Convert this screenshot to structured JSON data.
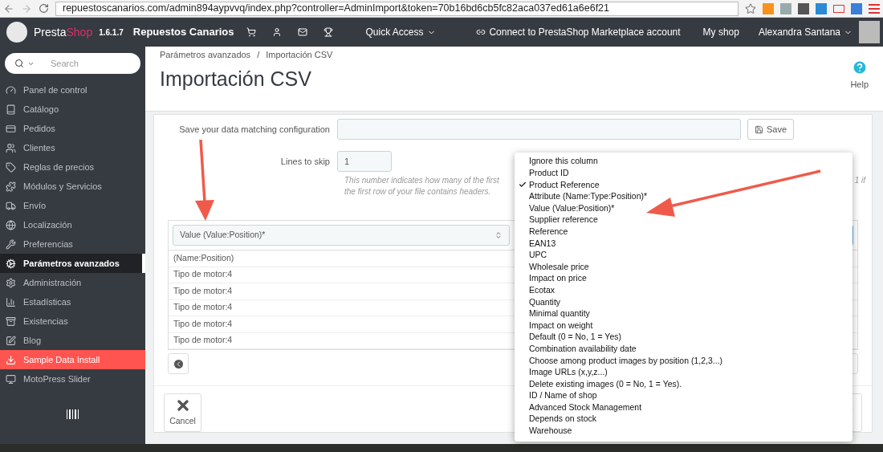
{
  "browser": {
    "url": "repuestoscanarios.com/admin894aypvvq/index.php?controller=AdminImport&token=70b16bd6cb5fc82aca037ed61a6e6f21"
  },
  "header": {
    "brand_left": "Presta",
    "brand_right": "Shop",
    "version": "1.6.1.7",
    "shop_name": "Repuestos Canarios",
    "quick_access": "Quick Access",
    "marketplace": "Connect to PrestaShop Marketplace account",
    "my_shop": "My shop",
    "user": "Alexandra Santana"
  },
  "sidebar": {
    "search_placeholder": "Search",
    "items": [
      {
        "label": "Panel de control",
        "selected": false,
        "kind": "normal"
      },
      {
        "label": "Catálogo",
        "selected": false,
        "kind": "normal"
      },
      {
        "label": "Pedidos",
        "selected": false,
        "kind": "normal"
      },
      {
        "label": "Clientes",
        "selected": false,
        "kind": "normal"
      },
      {
        "label": "Reglas de precios",
        "selected": false,
        "kind": "normal"
      },
      {
        "label": "Módulos y Servicios",
        "selected": false,
        "kind": "normal"
      },
      {
        "label": "Envío",
        "selected": false,
        "kind": "normal"
      },
      {
        "label": "Localización",
        "selected": false,
        "kind": "normal"
      },
      {
        "label": "Preferencias",
        "selected": false,
        "kind": "normal"
      },
      {
        "label": "Parámetros avanzados",
        "selected": true,
        "kind": "normal"
      },
      {
        "label": "Administración",
        "selected": false,
        "kind": "normal"
      },
      {
        "label": "Estadísticas",
        "selected": false,
        "kind": "normal"
      },
      {
        "label": "Existencias",
        "selected": false,
        "kind": "normal"
      },
      {
        "label": "Blog",
        "selected": false,
        "kind": "normal"
      },
      {
        "label": "Sample Data Install",
        "selected": false,
        "kind": "promo"
      },
      {
        "label": "MotoPress Slider",
        "selected": false,
        "kind": "normal"
      }
    ]
  },
  "page": {
    "breadcrumb": [
      "Parámetros avanzados",
      "Importación CSV"
    ],
    "breadcrumb_separator": "/",
    "title": "Importación CSV",
    "help": "Help"
  },
  "form": {
    "save_config_label": "Save your data matching configuration",
    "save_button": "Save",
    "lines_label": "Lines to skip",
    "lines_value": "1",
    "help_text_start": "This number indicates how many of the first",
    "help_text_end": "1 if",
    "help_text_line2": "the first row of your file contains headers."
  },
  "table": {
    "column_select": "Value (Value:Position)*",
    "rows": [
      "(Name:Position)",
      "Tipo de motor:4",
      "Tipo de motor:4",
      "Tipo de motor:4",
      "Tipo de motor:4",
      "Tipo de motor:4"
    ]
  },
  "footer": {
    "cancel": "Cancel"
  },
  "dropdown": {
    "options": [
      {
        "label": "Ignore this column",
        "selected": false
      },
      {
        "label": "Product ID",
        "selected": false
      },
      {
        "label": "Product Reference",
        "selected": true
      },
      {
        "label": "Attribute (Name:Type:Position)*",
        "selected": false
      },
      {
        "label": "Value (Value:Position)*",
        "selected": false
      },
      {
        "label": "Supplier reference",
        "selected": false
      },
      {
        "label": "Reference",
        "selected": false
      },
      {
        "label": "EAN13",
        "selected": false
      },
      {
        "label": "UPC",
        "selected": false
      },
      {
        "label": "Wholesale price",
        "selected": false
      },
      {
        "label": "Impact on price",
        "selected": false
      },
      {
        "label": "Ecotax",
        "selected": false
      },
      {
        "label": "Quantity",
        "selected": false
      },
      {
        "label": "Minimal quantity",
        "selected": false
      },
      {
        "label": "Impact on weight",
        "selected": false
      },
      {
        "label": "Default (0 = No, 1 = Yes)",
        "selected": false
      },
      {
        "label": "Combination availability date",
        "selected": false
      },
      {
        "label": "Choose among product images by position (1,2,3...)",
        "selected": false
      },
      {
        "label": "Image URLs (x,y,z...)",
        "selected": false
      },
      {
        "label": "Delete existing images (0 = No, 1 = Yes).",
        "selected": false
      },
      {
        "label": "ID / Name of shop",
        "selected": false
      },
      {
        "label": "Advanced Stock Management",
        "selected": false
      },
      {
        "label": "Depends on stock",
        "selected": false
      },
      {
        "label": "Warehouse",
        "selected": false
      }
    ]
  }
}
